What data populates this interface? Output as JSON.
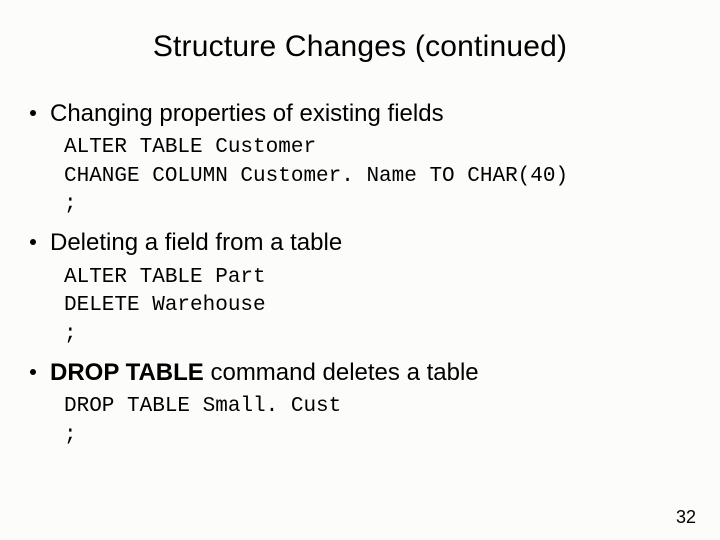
{
  "title": "Structure Changes (continued)",
  "bullets": [
    {
      "text_a": "Changing properties of existing fields",
      "bold": "",
      "text_b": "",
      "code": "ALTER TABLE Customer\nCHANGE COLUMN Customer. Name TO CHAR(40)\n;"
    },
    {
      "text_a": "Deleting a field from a table",
      "bold": "",
      "text_b": "",
      "code": "ALTER TABLE Part\nDELETE Warehouse\n;"
    },
    {
      "text_a": "",
      "bold": "DROP TABLE",
      "text_b": " command deletes a table",
      "code": "DROP TABLE Small. Cust\n;"
    }
  ],
  "page_number": "32"
}
